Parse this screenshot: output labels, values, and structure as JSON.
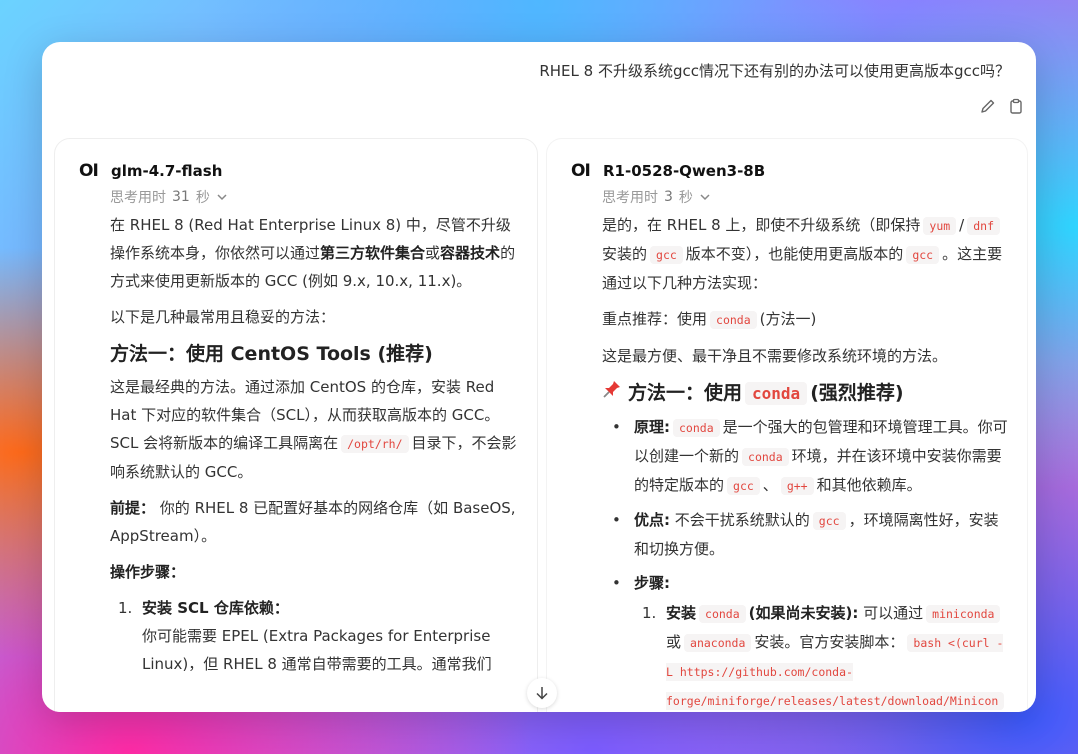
{
  "question": "RHEL 8 不升级系统gcc情况下还有别的办法可以使用更高版本gcc吗？",
  "icons": {
    "edit": "pencil-icon",
    "copy": "clipboard-icon",
    "scroll": "arrow-down-icon"
  },
  "left": {
    "logo": "OI",
    "model": "glm-4.7-flash",
    "thinking_prefix": "思考用时",
    "thinking_num": "31",
    "thinking_unit": "秒",
    "intro_a": "在 RHEL 8 (Red Hat Enterprise Linux 8) 中，尽管不升级操作系统本身，你依然可以通过",
    "intro_b1": "第三方软件集合",
    "intro_or": "或",
    "intro_b2": "容器技术",
    "intro_c": "的方式来使用更新版本的 GCC (例如 9.x, 10.x, 11.x)。",
    "common": "以下是几种最常用且稳妥的方法：",
    "method1": "方法一：使用 CentOS Tools (推荐)",
    "m1_a": "这是最经典的方法。通过添加 CentOS 的仓库，安装 Red Hat 下对应的软件集合（SCL），从而获取高版本的 GCC。SCL 会将新版本的编译工具隔离在",
    "m1_code": "/opt/rh/",
    "m1_b": "目录下，不会影响系统默认的 GCC。",
    "pre_label": "前提：",
    "pre_text": "你的 RHEL 8 已配置好基本的网络仓库（如 BaseOS, AppStream）。",
    "steps_label": "操作步骤：",
    "step1_num": "1.",
    "step1_title": "安装 SCL 仓库依赖：",
    "step1_text": "你可能需要 EPEL (Extra Packages for Enterprise Linux)，但 RHEL 8 通常自带需要的工具。通常我们"
  },
  "right": {
    "logo": "OI",
    "model": "R1-0528-Qwen3-8B",
    "thinking_prefix": "思考用时",
    "thinking_num": "3",
    "thinking_unit": "秒",
    "p1_a": "是的，在 RHEL 8 上，即使不升级系统（即保持",
    "p1_code1": "yum",
    "p1_slash": "/",
    "p1_code2": "dnf",
    "p1_b": "安装的",
    "p1_code3": "gcc",
    "p1_c": "版本不变），也能使用更高版本的",
    "p1_code4": "gcc",
    "p1_d": "。这主要通过以下几种方法实现：",
    "rec_a": "重点推荐：使用",
    "rec_code": "conda",
    "rec_b": "(方法一)",
    "easy": "这是最方便、最干净且不需要修改系统环境的方法。",
    "method1_a": "方法一：使用",
    "method1_code": "conda",
    "method1_b": "(强烈推荐)",
    "b1_label": "原理:",
    "b1_code1": "conda",
    "b1_a": "是一个强大的包管理和环境管理工具。你可以创建一个新的",
    "b1_code2": "conda",
    "b1_b": "环境，并在该环境中安装你需要的特定版本的",
    "b1_code3": "gcc",
    "b1_sep": "、",
    "b1_code4": "g++",
    "b1_c": "和其他依赖库。",
    "b2_label": "优点:",
    "b2_a": "不会干扰系统默认的",
    "b2_code": "gcc",
    "b2_b": "，环境隔离性好，安装和切换方便。",
    "b3_label": "步骤:",
    "s1_num": "1.",
    "s1_label": "安装",
    "s1_code": "conda",
    "s1_bold": "(如果尚未安装):",
    "s1_a": "可以通过",
    "s1_code2": "miniconda",
    "s1_or": "或",
    "s1_code3": "anaconda",
    "s1_b": "安装。官方安装脚本：",
    "s1_cmd": "bash <(curl -L https://github.com/conda-forge/miniforge/releases/latest/download/Minicon"
  }
}
